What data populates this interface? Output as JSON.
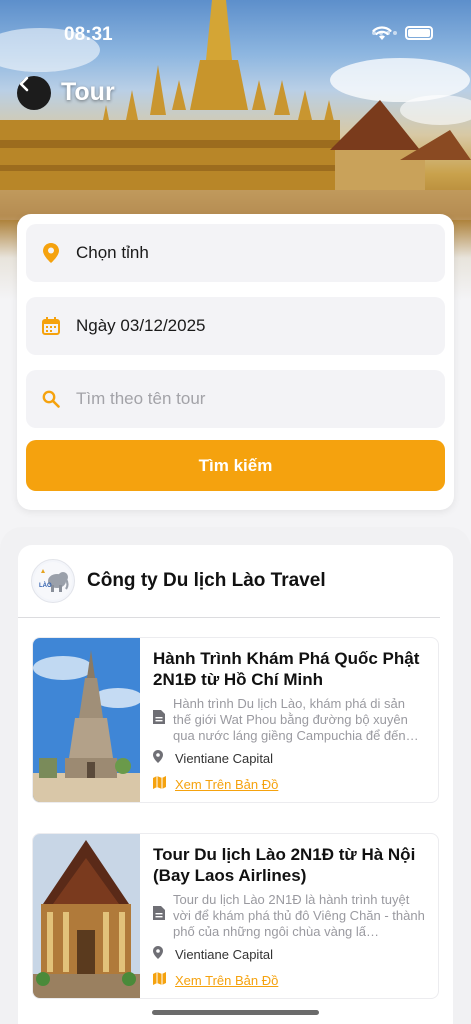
{
  "status_bar": {
    "time": "08:31"
  },
  "header": {
    "title": "Tour"
  },
  "search": {
    "province_label": "Chọn tỉnh",
    "date_label": "Ngày 03/12/2025",
    "name_placeholder": "Tìm theo tên tour",
    "button_label": "Tìm kiếm"
  },
  "company": {
    "name": "Công ty Du lịch Lào Travel",
    "tours": [
      {
        "title": "Hành Trình Khám Phá Quốc Phật 2N1Đ từ Hồ Chí Minh",
        "description": "Hành trình Du lịch Lào, khám phá di sản thế giới Wat Phou bằng đường bộ xuyên qua nước láng giềng Campuchia để đến…",
        "location": "Vientiane Capital",
        "map_link": "Xem Trên Bản Đồ"
      },
      {
        "title": "Tour Du lịch Lào 2N1Đ từ Hà Nội (Bay Laos Airlines)",
        "description": "Tour du lịch Lào 2N1Đ là hành trình tuyệt vời để khám phá thủ đô Viêng Chăn - thành phố của những ngôi chùa vàng lấ…",
        "location": "Vientiane Capital",
        "map_link": "Xem Trên Bản Đồ"
      }
    ]
  },
  "colors": {
    "accent": "#f5a20e",
    "back_button": "#1c1c1c"
  },
  "icons": [
    "back-icon",
    "location-pin-icon",
    "calendar-icon",
    "search-icon",
    "document-icon",
    "map-icon",
    "wifi-icon",
    "battery-icon"
  ]
}
